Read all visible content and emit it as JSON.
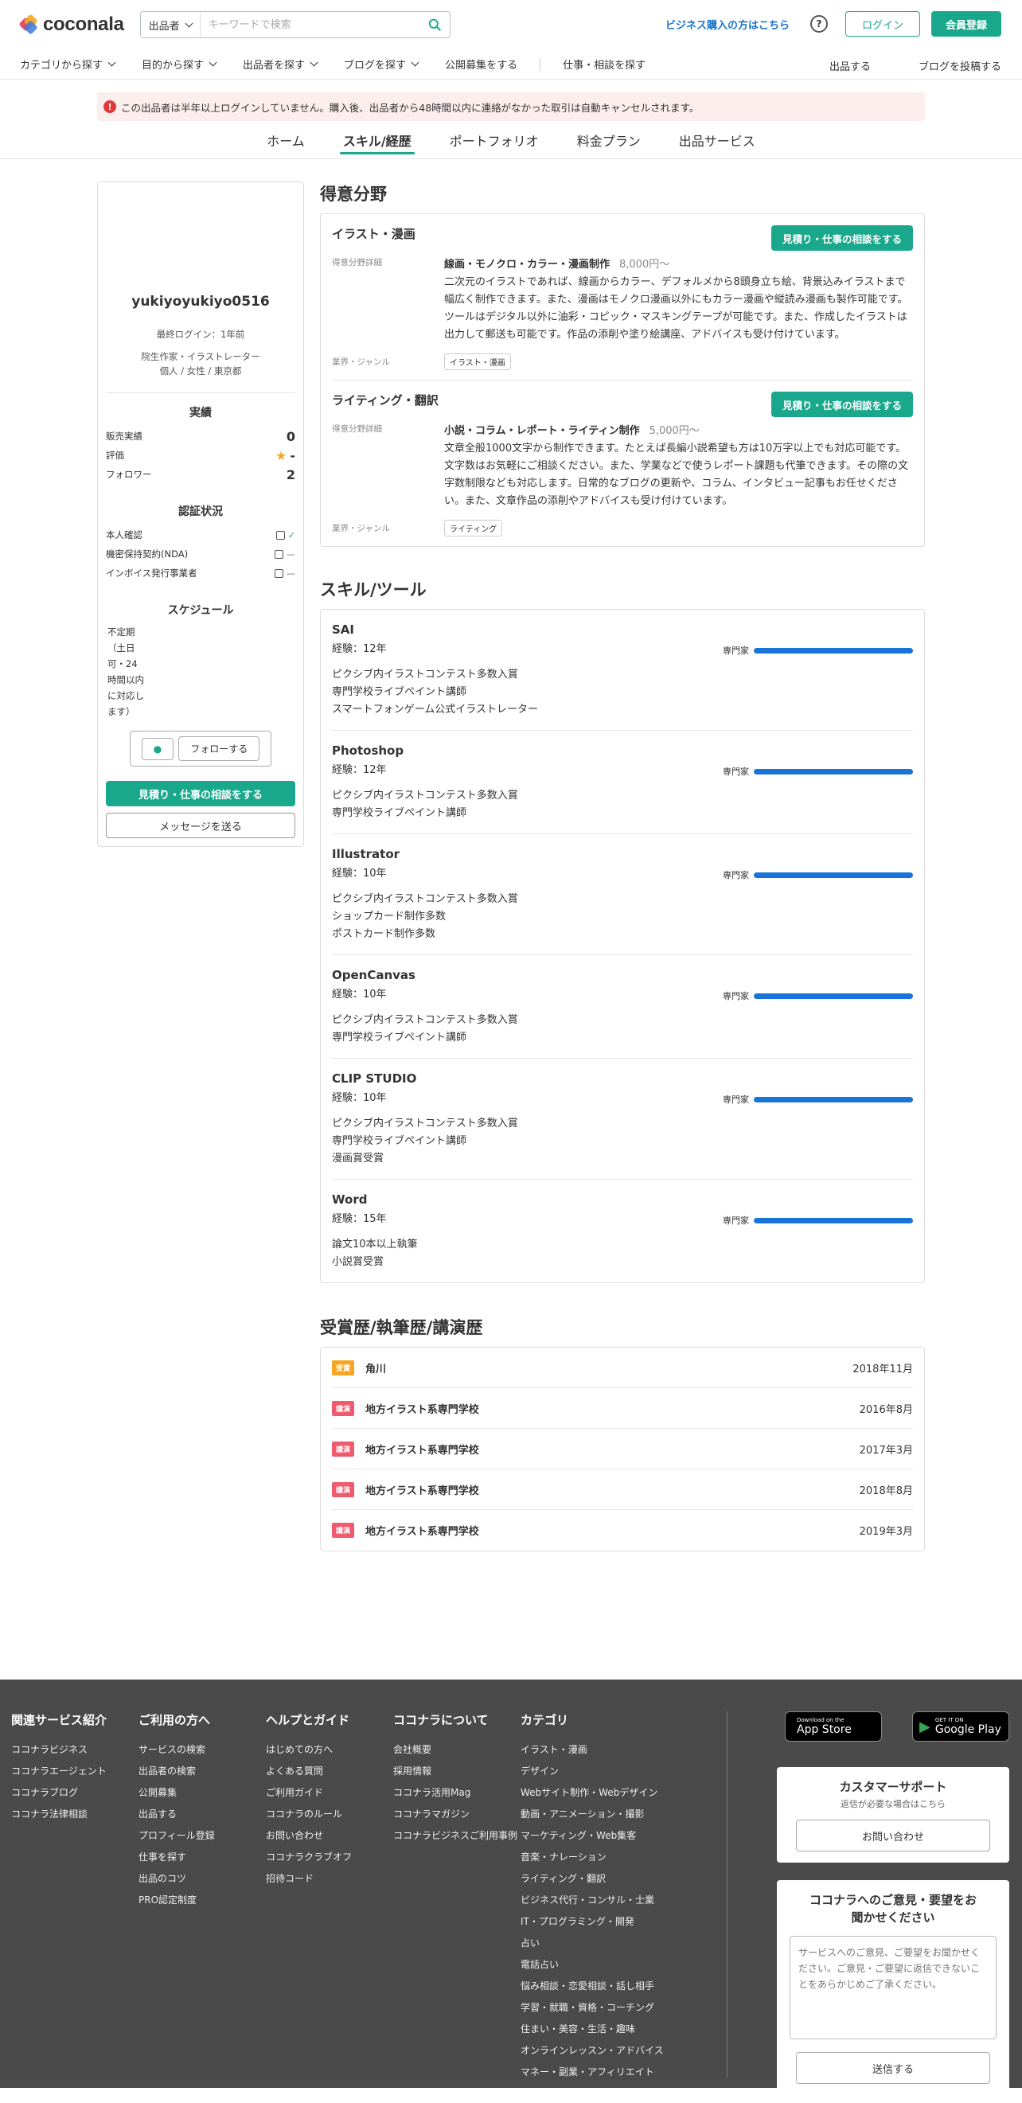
{
  "header": {
    "logo": "coconala",
    "search_select": "出品者",
    "search_placeholder": "キーワードで検索",
    "biz_link": "ビジネス購入の方はこちら",
    "login": "ログイン",
    "register": "会員登録"
  },
  "nav": {
    "items": [
      "カテゴリから探す",
      "目的から探す",
      "出品者を探す",
      "ブログを探す",
      "公開募集をする"
    ],
    "consult": "仕事・相談を探す",
    "right": [
      "出品する",
      "ブログを投稿する"
    ]
  },
  "alert": "この出品者は半年以上ログインしていません。購入後、出品者から48時間以内に連絡がなかった取引は自動キャンセルされます。",
  "tabs": [
    "ホーム",
    "スキル/経歴",
    "ポートフォリオ",
    "料金プラン",
    "出品サービス"
  ],
  "profile": {
    "name": "yukiyoyukiyo0516",
    "last_login": "最終ログイン：1年前",
    "title": "院生作家・イラストレーター",
    "attrs": "個人 / 女性 / 東京都",
    "stats_title": "実績",
    "sales_label": "販売実績",
    "sales_value": "0",
    "rating_label": "評価",
    "rating_value": "-",
    "followers_label": "フォロワー",
    "followers_value": "2",
    "verify_title": "認証状況",
    "verify": [
      {
        "label": "本人確認",
        "status": "✓"
      },
      {
        "label": "機密保持契約(NDA)",
        "status": "—"
      },
      {
        "label": "インボイス発行事業者",
        "status": "—"
      }
    ],
    "schedule_title": "スケジュール",
    "schedule": "不定期（土日可・24時間以内に対応します）",
    "follow": "フォローする",
    "consult": "見積り・仕事の相談をする",
    "message": "メッセージを送る"
  },
  "fields": {
    "title": "得意分野",
    "detail_label": "得意分野詳細",
    "genre_label": "業界・ジャンル",
    "button": "見積り・仕事の相談をする",
    "items": [
      {
        "name": "イラスト・漫画",
        "head": "線画・モノクロ・カラー・漫画制作",
        "price": "8,000円〜",
        "text": "二次元のイラストであれば、線画からカラー、デフォルメから8頭身立ち絵、背景込みイラストまで幅広く制作できます。また、漫画はモノクロ漫画以外にもカラー漫画や縦読み漫画も製作可能です。ツールはデジタル以外に油彩・コピック・マスキングテープが可能です。また、作成したイラストは出力して郵送も可能です。作品の添削や塗り絵講座、アドバイスも受け付けています。",
        "tag": "イラスト・漫画"
      },
      {
        "name": "ライティング・翻訳",
        "head": "小説・コラム・レポート・ライティン制作",
        "price": "5,000円〜",
        "text": "文章全般1000文字から制作できます。たとえば長編小説希望も方は10万字以上でも対応可能です。文字数はお気軽にご相談ください。また、学業などで使うレポート課題も代筆できます。その際の文字数制限なども対応します。日常的なブログの更新や、コラム、インタビュー記事もお任せください。また、文章作品の添削やアドバイスも受け付けています。",
        "tag": "ライティング"
      }
    ]
  },
  "skills": {
    "title": "スキル/ツール",
    "items": [
      {
        "name": "SAI",
        "exp": "経験：12年",
        "level": "専門家",
        "level_pct": 100,
        "desc": [
          "ピクシブ内イラストコンテスト多数入賞",
          "専門学校ライブペイント講師",
          "スマートフォンゲーム公式イラストレーター"
        ]
      },
      {
        "name": "Photoshop",
        "exp": "経験：12年",
        "level": "専門家",
        "level_pct": 100,
        "desc": [
          "ピクシブ内イラストコンテスト多数入賞",
          "専門学校ライブペイント講師"
        ]
      },
      {
        "name": "Illustrator",
        "exp": "経験：10年",
        "level": "専門家",
        "level_pct": 100,
        "desc": [
          "ピクシブ内イラストコンテスト多数入賞",
          "ショップカード制作多数",
          "ポストカード制作多数"
        ]
      },
      {
        "name": "OpenCanvas",
        "exp": "経験：10年",
        "level": "専門家",
        "level_pct": 100,
        "desc": [
          "ピクシブ内イラストコンテスト多数入賞",
          "専門学校ライブペイント講師"
        ]
      },
      {
        "name": "CLIP STUDIO",
        "exp": "経験：10年",
        "level": "専門家",
        "level_pct": 100,
        "desc": [
          "ピクシブ内イラストコンテスト多数入賞",
          "専門学校ライブペイント講師",
          "漫画賞受賞"
        ]
      },
      {
        "name": "Word",
        "exp": "経験：15年",
        "level": "専門家",
        "level_pct": 100,
        "desc": [
          "論文10本以上執筆",
          "小説賞受賞"
        ]
      }
    ]
  },
  "awards": {
    "title": "受賞歴/執筆歴/講演歴",
    "items": [
      {
        "type": "受賞",
        "color": "#f5a623",
        "name": "角川",
        "date": "2018年11月"
      },
      {
        "type": "講演",
        "color": "#ef5b6e",
        "name": "地方イラスト系専門学校",
        "date": "2016年8月"
      },
      {
        "type": "講演",
        "color": "#ef5b6e",
        "name": "地方イラスト系専門学校",
        "date": "2017年3月"
      },
      {
        "type": "講演",
        "color": "#ef5b6e",
        "name": "地方イラスト系専門学校",
        "date": "2018年8月"
      },
      {
        "type": "講演",
        "color": "#ef5b6e",
        "name": "地方イラスト系専門学校",
        "date": "2019年3月"
      }
    ]
  },
  "footer": {
    "columns": [
      {
        "title": "関連サービス紹介",
        "links": [
          "ココナラビジネス",
          "ココナラエージェント",
          "ココナラブログ",
          "ココナラ法律相談"
        ]
      },
      {
        "title": "ご利用の方へ",
        "links": [
          "サービスの検索",
          "出品者の検索",
          "公開募集",
          "出品する",
          "プロフィール登録",
          "仕事を探す",
          "出品のコツ",
          "PRO認定制度"
        ]
      },
      {
        "title": "ヘルプとガイド",
        "links": [
          "はじめての方へ",
          "よくある質問",
          "ご利用ガイド",
          "ココナラのルール",
          "お問い合わせ",
          "ココナラクラブオフ",
          "招待コード"
        ]
      },
      {
        "title": "ココナラについて",
        "links": [
          "会社概要",
          "採用情報",
          "ココナラ活用Mag",
          "ココナラマガジン",
          "ココナラビジネスご利用事例"
        ]
      },
      {
        "title": "カテゴリ",
        "links": [
          "イラスト・漫画",
          "デザイン",
          "Webサイト制作・Webデザイン",
          "動画・アニメーション・撮影",
          "マーケティング・Web集客",
          "音楽・ナレーション",
          "ライティング・翻訳",
          "ビジネス代行・コンサル・士業",
          "IT・プログラミング・開発",
          "占い",
          "電話占い",
          "悩み相談・恋愛相談・話し相手",
          "学習・就職・資格・コーチング",
          "住まい・美容・生活・趣味",
          "オンラインレッスン・アドバイス",
          "マネー・副業・アフィリエイト"
        ]
      }
    ],
    "appstore_small": "Download on the",
    "appstore": "App Store",
    "googleplay_small": "GET IT ON",
    "googleplay": "Google Play",
    "support_title": "カスタマーサポート",
    "support_sub": "返信が必要な場合はこちら",
    "support_btn": "お問い合わせ",
    "feedback_title": "ココナラへのご意見・要望をお聞かせください",
    "feedback_placeholder": "サービスへのご意見、ご要望をお聞かせください。ご意見・ご要望に返信できないことをあらかじめご了承ください。",
    "send": "送信する"
  },
  "colors": {
    "accent": "#1aa88c",
    "level_bar": "#1a73d9",
    "alert_bg": "#fdeeee"
  }
}
